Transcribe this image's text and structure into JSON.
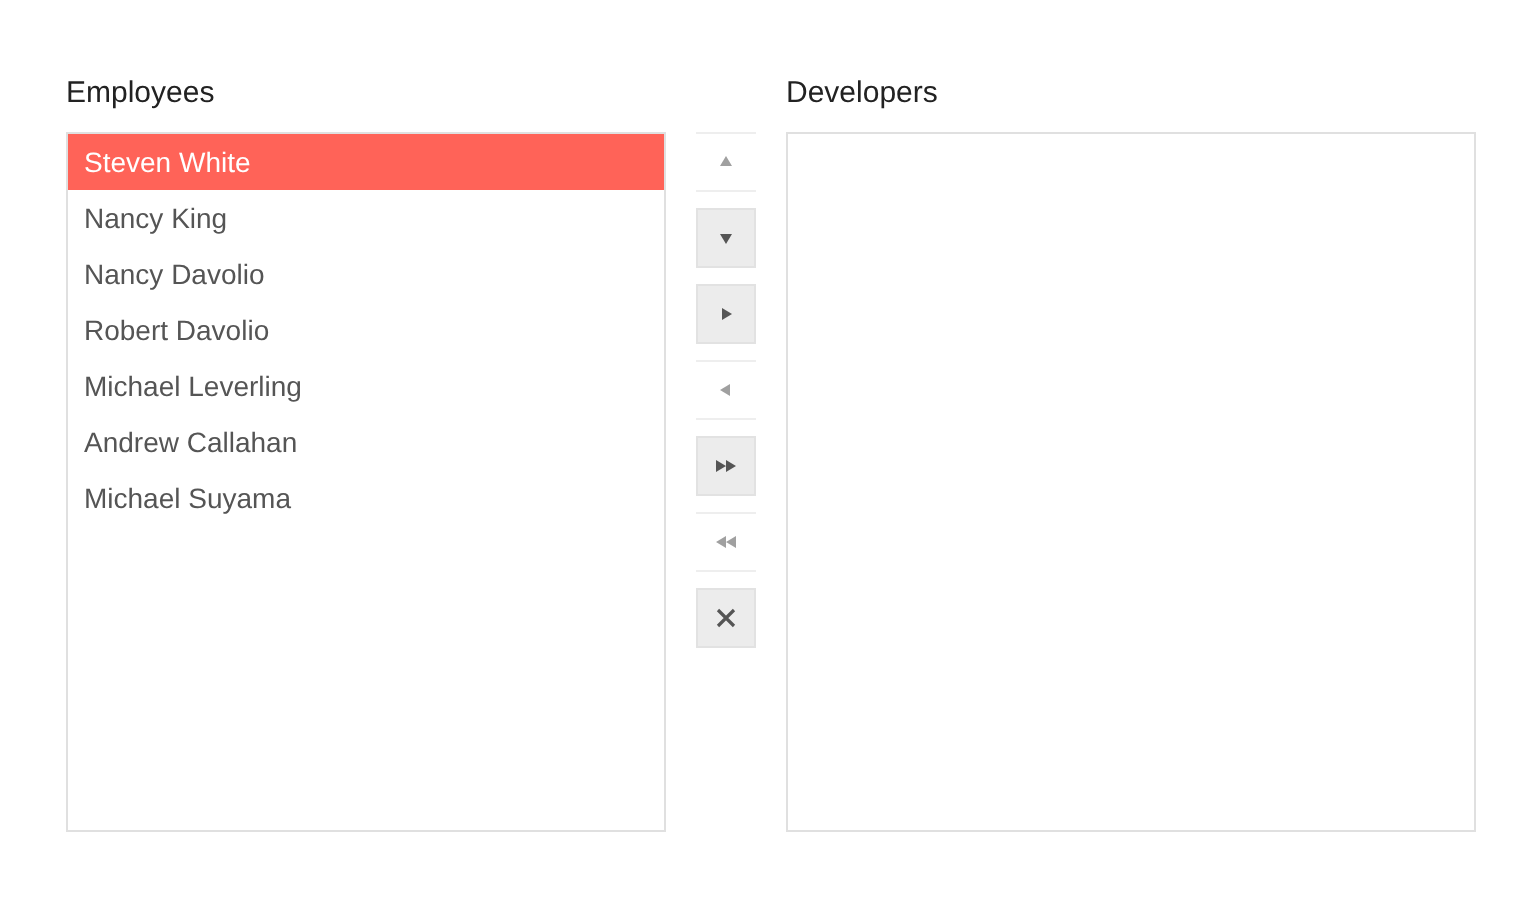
{
  "lists": [
    {
      "title": "Employees",
      "items": [
        {
          "label": "Steven White",
          "selected": true
        },
        {
          "label": "Nancy King",
          "selected": false
        },
        {
          "label": "Nancy Davolio",
          "selected": false
        },
        {
          "label": "Robert Davolio",
          "selected": false
        },
        {
          "label": "Michael Leverling",
          "selected": false
        },
        {
          "label": "Andrew Callahan",
          "selected": false
        },
        {
          "label": "Michael Suyama",
          "selected": false
        }
      ]
    },
    {
      "title": "Developers"
    }
  ],
  "tools": [
    {
      "kind": "up",
      "disabled": true
    },
    {
      "kind": "down",
      "disabled": false
    },
    {
      "kind": "right",
      "disabled": false
    },
    {
      "kind": "left",
      "disabled": true
    },
    {
      "kind": "all-right",
      "disabled": false
    },
    {
      "kind": "all-left",
      "disabled": true
    },
    {
      "kind": "remove",
      "disabled": false
    }
  ]
}
